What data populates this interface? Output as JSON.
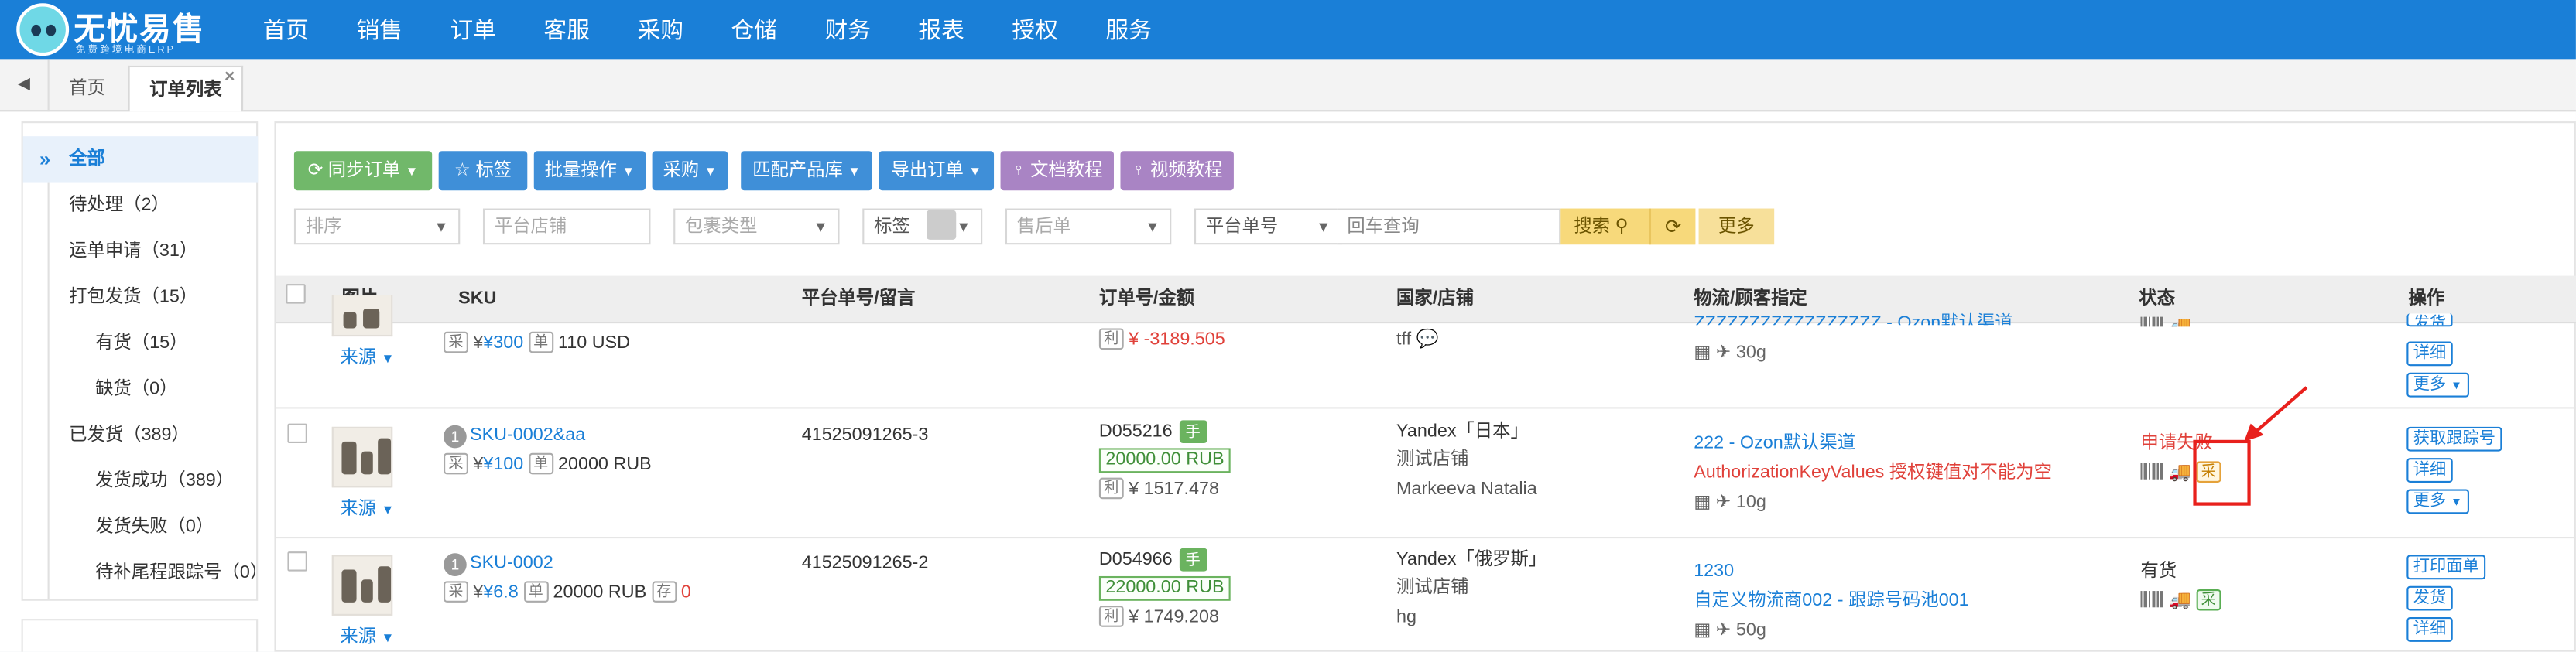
{
  "brand": {
    "title": "无忧易售",
    "subtitle": "免费跨境电商ERP"
  },
  "nav": [
    "首页",
    "销售",
    "订单",
    "客服",
    "采购",
    "仓储",
    "财务",
    "报表",
    "授权",
    "服务"
  ],
  "tabs": {
    "home": "首页",
    "orders": "订单列表",
    "close": "×"
  },
  "sidebar": {
    "all": "全部",
    "items": [
      "待处理（2）",
      "运单申请（31）",
      "打包发货（15）",
      "有货（15）",
      "缺货（0）",
      "已发货（389）",
      "发货成功（389）",
      "发货失败（0）",
      "待补尾程跟踪号（0）"
    ]
  },
  "toolbar": {
    "sync": "同步订单",
    "tag": "标签",
    "batch": "批量操作",
    "purchase": "采购",
    "match": "匹配产品库",
    "export": "导出订单",
    "doc": "文档教程",
    "video": "视频教程"
  },
  "filters": {
    "sort": "排序",
    "shop": "平台店铺",
    "package": "包裹类型",
    "tag": "标签",
    "aftersale": "售后单",
    "platform_no": "平台单号",
    "query_placeholder": "回车查询",
    "search": "搜索",
    "more": "更多"
  },
  "table": {
    "headers": [
      "图片",
      "SKU",
      "平台单号/留言",
      "订单号/金额",
      "国家/店铺",
      "物流/顾客指定",
      "状态",
      "操作"
    ]
  },
  "rows": {
    "r0": {
      "source": "来源",
      "cg": "采",
      "price": "¥300",
      "unit": "单",
      "qty": "110 USD",
      "li": "利",
      "profit": "¥ -3189.505",
      "shop": "tff",
      "logistics": "ZZZZZZZZZZZZZZZZZ - Ozon默认渠道",
      "weight": "30g",
      "ops": [
        "发货",
        "详细",
        "更多"
      ]
    },
    "r1": {
      "num": "1",
      "sku": "SKU-0002&aa",
      "source": "来源",
      "cg": "采",
      "price": "¥100",
      "unit": "单",
      "qty": "20000 RUB",
      "platform_no": "41525091265-3",
      "order_no": "D055216",
      "hand": "手",
      "amount": "20000.00 RUB",
      "li": "利",
      "profit": "¥ 1517.478",
      "country": "Yandex「日本」",
      "shop": "测试店铺",
      "customer": "Markeeva Natalia",
      "logistics": "222 - Ozon默认渠道",
      "error": "AuthorizationKeyValues 授权键值对不能为空",
      "weight": "10g",
      "status": "申请失败",
      "status_tag": "采",
      "ops": [
        "获取跟踪号",
        "详细",
        "更多"
      ]
    },
    "r2": {
      "num": "1",
      "sku": "SKU-0002",
      "source": "来源",
      "cg": "采",
      "price": "¥6.8",
      "unit": "单",
      "qty": "20000 RUB",
      "stock_label": "存",
      "stock": "0",
      "platform_no": "41525091265-2",
      "order_no": "D054966",
      "hand": "手",
      "amount": "22000.00 RUB",
      "li": "利",
      "profit": "¥ 1749.208",
      "country": "Yandex「俄罗斯」",
      "shop": "测试店铺",
      "customer": "hg",
      "logistics": "1230",
      "logistics2": "自定义物流商002 - 跟踪号码池001",
      "weight": "50g",
      "status": "有货",
      "status_tag": "采",
      "ops": [
        "打印面单",
        "发货",
        "详细"
      ]
    }
  },
  "colors": {
    "nav": "#1a7fd7",
    "green": "#71b86a",
    "blue": "#3f8fd8",
    "purple": "#a984c4",
    "error": "#e0413a",
    "highlight": "#e8201c"
  }
}
